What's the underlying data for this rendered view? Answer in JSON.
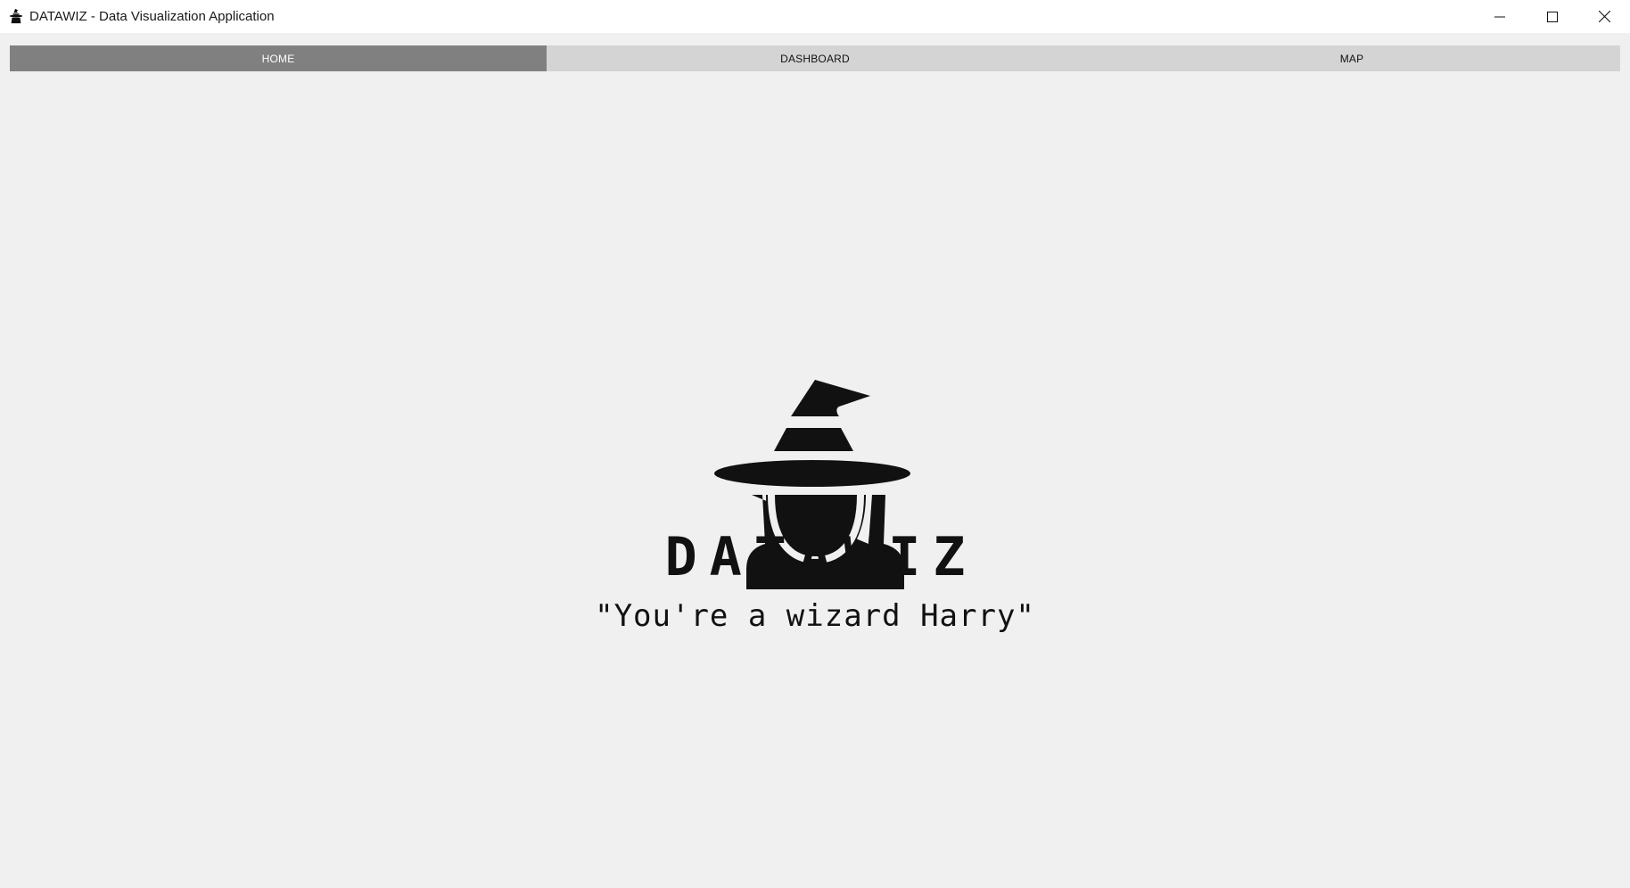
{
  "window": {
    "title": "DATAWIZ - Data Visualization Application",
    "app_icon": "wizard-icon",
    "controls": {
      "minimize_icon": "minimize-icon",
      "maximize_icon": "maximize-icon",
      "close_icon": "close-icon"
    }
  },
  "tabs": [
    {
      "label": "HOME",
      "active": true
    },
    {
      "label": "DASHBOARD",
      "active": false
    },
    {
      "label": "MAP",
      "active": false
    }
  ],
  "home": {
    "logo_icon": "wizard-hat-logo",
    "brand_name": "DATAWIZ",
    "tagline": "\"You're a wizard Harry\""
  },
  "colors": {
    "active_tab_bg": "#808080",
    "tab_bar_bg": "#d4d4d4",
    "background": "#f0f0f0",
    "logo": "#111111"
  }
}
